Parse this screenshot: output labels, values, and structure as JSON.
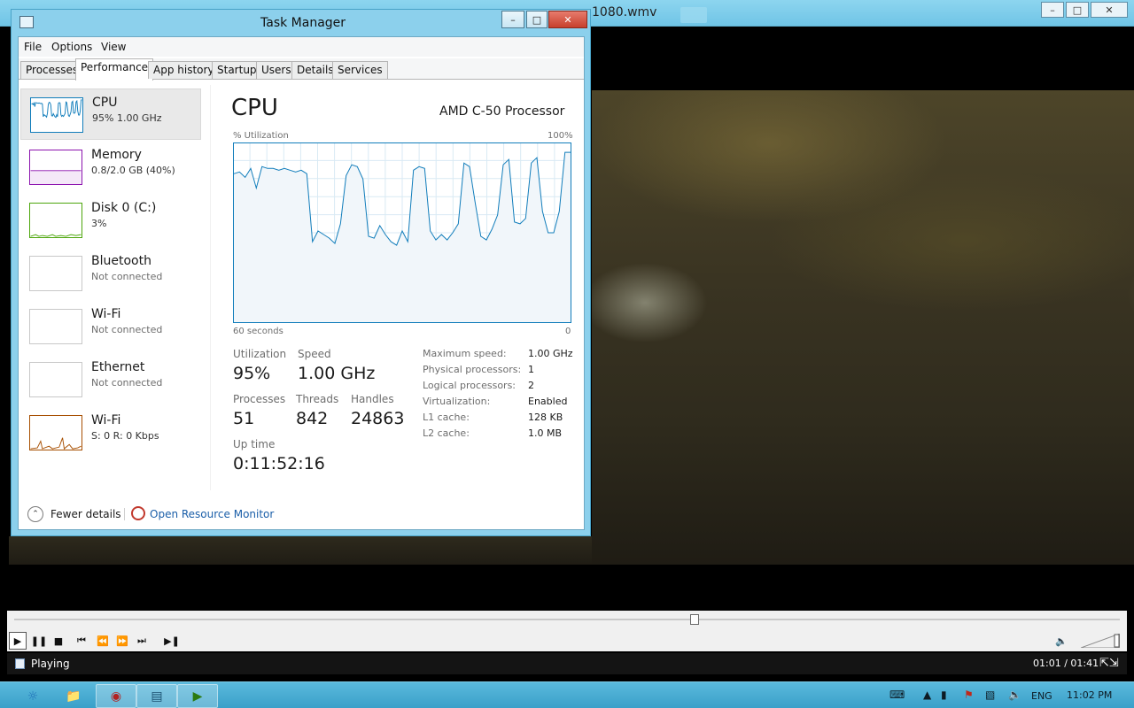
{
  "player": {
    "title": "1080.wmv",
    "status": "Playing",
    "time": "01:01 / 01:41",
    "seek_fraction": 0.615
  },
  "taskmanager": {
    "title": "Task Manager",
    "menu": [
      "File",
      "Options",
      "View"
    ],
    "tabs": [
      "Processes",
      "Performance",
      "App history",
      "Startup",
      "Users",
      "Details",
      "Services"
    ],
    "active_tab": "Performance",
    "sidebar": [
      {
        "name": "CPU",
        "sub": "95%  1.00 GHz",
        "color": "#117dbb"
      },
      {
        "name": "Memory",
        "sub": "0.8/2.0 GB (40%)",
        "color": "#8b12ae"
      },
      {
        "name": "Disk 0 (C:)",
        "sub": "3%",
        "color": "#4da60c"
      },
      {
        "name": "Bluetooth",
        "sub": "Not connected",
        "color": "#c8c8c8"
      },
      {
        "name": "Wi-Fi",
        "sub": "Not connected",
        "color": "#c8c8c8"
      },
      {
        "name": "Ethernet",
        "sub": "Not connected",
        "color": "#c8c8c8"
      },
      {
        "name": "Wi-Fi",
        "sub": "S: 0 R: 0 Kbps",
        "color": "#a74f01"
      }
    ],
    "main": {
      "title": "CPU",
      "processor": "AMD C-50 Processor",
      "util_label": "% Utilization",
      "max_label": "100%",
      "time_label": "60 seconds",
      "zero_label": "0",
      "stats": {
        "utilization_label": "Utilization",
        "utilization": "95%",
        "speed_label": "Speed",
        "speed": "1.00 GHz",
        "processes_label": "Processes",
        "processes": "51",
        "threads_label": "Threads",
        "threads": "842",
        "handles_label": "Handles",
        "handles": "24863",
        "uptime_label": "Up time",
        "uptime": "0:11:52:16"
      },
      "details": [
        {
          "key": "Maximum speed:",
          "value": "1.00 GHz"
        },
        {
          "key": "Physical processors:",
          "value": "1"
        },
        {
          "key": "Logical processors:",
          "value": "2"
        },
        {
          "key": "Virtualization:",
          "value": "Enabled"
        },
        {
          "key": "L1 cache:",
          "value": "128 KB"
        },
        {
          "key": "L2 cache:",
          "value": "1.0 MB"
        }
      ]
    },
    "fewer_details": "Fewer details",
    "resource_monitor": "Open Resource Monitor"
  },
  "chart_data": {
    "type": "line",
    "ylim": [
      0,
      100
    ],
    "series": [
      {
        "values": [
          83,
          84,
          81,
          86,
          75,
          87,
          86,
          86,
          85,
          86,
          85,
          84,
          85,
          83,
          45,
          51,
          49,
          47,
          44,
          55,
          82,
          88,
          87,
          80,
          48,
          47,
          54,
          49,
          45,
          43,
          51,
          45,
          85,
          87,
          86,
          51,
          46,
          49,
          46,
          50,
          55,
          89,
          87,
          67,
          48,
          46,
          52,
          60,
          88,
          91,
          56,
          55,
          58,
          89,
          92,
          62,
          50,
          50,
          62,
          95,
          95
        ]
      }
    ]
  },
  "tray": {
    "lang": "ENG",
    "clock": "11:02 PM"
  }
}
